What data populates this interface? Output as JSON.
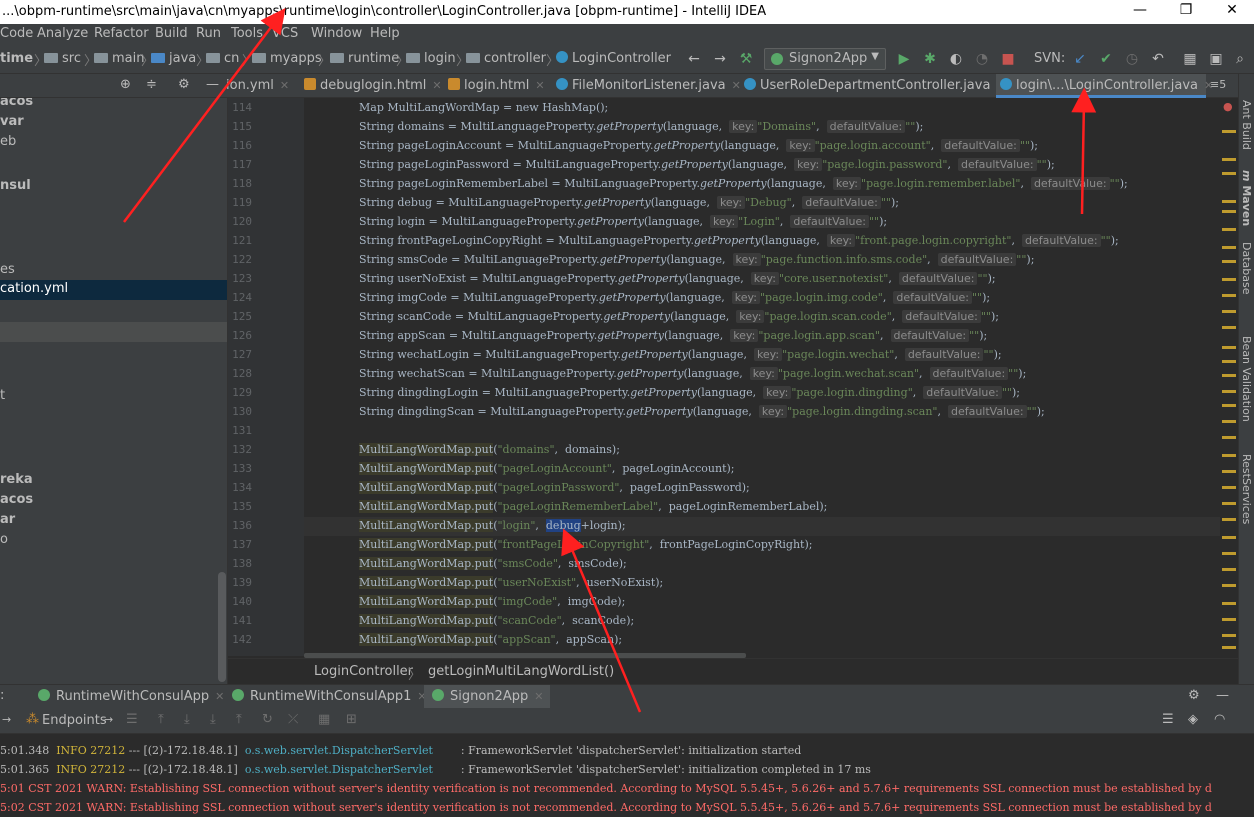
{
  "window": {
    "title": "...\\obpm-runtime\\src\\main\\java\\cn\\myapps\\runtime\\login\\controller\\LoginController.java [obpm-runtime] - IntelliJ IDEA",
    "minimize": "—",
    "maximize": "❐",
    "close": "✕"
  },
  "menu": [
    "Code",
    "Analyze",
    "Refactor",
    "Build",
    "Run",
    "Tools",
    "VCS",
    "Window",
    "Help"
  ],
  "breadcrumb": [
    "time",
    "src",
    "main",
    "java",
    "cn",
    "myapps",
    "runtime",
    "login",
    "controller",
    "LoginController"
  ],
  "toolbar": {
    "run_config": "Signon2App",
    "svn_label": "SVN:"
  },
  "tabs": [
    {
      "label": "ion.yml",
      "active": false
    },
    {
      "label": "debuglogin.html",
      "active": false
    },
    {
      "label": "login.html",
      "active": false
    },
    {
      "label": "FileMonitorListener.java",
      "active": false
    },
    {
      "label": "UserRoleDepartmentController.java",
      "active": false
    },
    {
      "label": "login\\...\\LoginController.java",
      "active": true
    }
  ],
  "tabs_overflow": "≡5",
  "left_panel": [
    {
      "label": "acos",
      "bold": true
    },
    {
      "label": "var",
      "bold": true
    },
    {
      "label": "eb",
      "bold": false
    },
    {
      "label": "nsul",
      "bold": true
    },
    {
      "label": "es",
      "bold": false
    },
    {
      "label": "cation.yml",
      "bold": false
    },
    {
      "label": "t",
      "bold": false
    },
    {
      "label": "reka",
      "bold": true
    },
    {
      "label": "acos",
      "bold": true
    },
    {
      "label": "ar",
      "bold": true
    },
    {
      "label": "o",
      "bold": false
    }
  ],
  "code": {
    "line_numbers": [
      "114",
      "115",
      "116",
      "117",
      "118",
      "119",
      "120",
      "121",
      "122",
      "123",
      "124",
      "125",
      "126",
      "127",
      "128",
      "129",
      "130",
      "131",
      "132",
      "133",
      "134",
      "135",
      "136",
      "137",
      "138",
      "139",
      "140",
      "141",
      "142"
    ],
    "first_line": "Map MultiLangWordMap = new HashMap();",
    "decls": [
      {
        "ln": "115",
        "name": "domains",
        "key": "Domains"
      },
      {
        "ln": "116",
        "name": "pageLoginAccount",
        "key": "page.login.account"
      },
      {
        "ln": "117",
        "name": "pageLoginPassword",
        "key": "page.login.password"
      },
      {
        "ln": "118",
        "name": "pageLoginRememberLabel",
        "key": "page.login.remember.label"
      },
      {
        "ln": "119",
        "name": "debug",
        "key": "Debug"
      },
      {
        "ln": "120",
        "name": "login",
        "key": "Login"
      },
      {
        "ln": "121",
        "name": "frontPageLoginCopyRight",
        "key": "front.page.login.copyright"
      },
      {
        "ln": "122",
        "name": "smsCode",
        "key": "page.function.info.sms.code"
      },
      {
        "ln": "123",
        "name": "userNoExist",
        "key": "core.user.notexist"
      },
      {
        "ln": "124",
        "name": "imgCode",
        "key": "page.login.img.code"
      },
      {
        "ln": "125",
        "name": "scanCode",
        "key": "page.login.scan.code"
      },
      {
        "ln": "126",
        "name": "appScan",
        "key": "page.login.app.scan"
      },
      {
        "ln": "127",
        "name": "wechatLogin",
        "key": "page.login.wechat"
      },
      {
        "ln": "128",
        "name": "wechatScan",
        "key": "page.login.wechat.scan"
      },
      {
        "ln": "129",
        "name": "dingdingLogin",
        "key": "page.login.dingding"
      },
      {
        "ln": "130",
        "name": "dingdingScan",
        "key": "page.login.dingding.scan"
      }
    ],
    "puts": [
      {
        "key": "domains",
        "val": "domains"
      },
      {
        "key": "pageLoginAccount",
        "val": "pageLoginAccount"
      },
      {
        "key": "pageLoginPassword",
        "val": "pageLoginPassword"
      },
      {
        "key": "pageLoginRememberLabel",
        "val": "pageLoginRememberLabel"
      },
      {
        "key": "login",
        "val": "debug+login"
      },
      {
        "key": "frontPageLoginCopyright",
        "val": "frontPageLoginCopyRight"
      },
      {
        "key": "smsCode",
        "val": "smsCode"
      },
      {
        "key": "userNoExist",
        "val": "userNoExist"
      },
      {
        "key": "imgCode",
        "val": "imgCode"
      },
      {
        "key": "scanCode",
        "val": "scanCode"
      },
      {
        "key": "appScan",
        "val": "appScan"
      }
    ],
    "hint_key": "key:",
    "hint_default": "defaultValue:",
    "type_string": "String",
    "lang_class": "MultiLanguageProperty",
    "get_method": "getProperty",
    "lang_arg": "language",
    "map_var": "MultiLangWordMap",
    "put_method": "put"
  },
  "editor_crumbs": [
    "LoginController",
    "getLoginMultiLangWordList()"
  ],
  "right_tools": [
    "Ant Build",
    "Maven",
    "Database",
    "Bean Validation",
    "RestServices"
  ],
  "run_tabs": [
    {
      "label": "RuntimeWithConsulApp",
      "active": false
    },
    {
      "label": "RuntimeWithConsulApp1",
      "active": false
    },
    {
      "label": "Signon2App",
      "active": true
    }
  ],
  "run_toolbar": {
    "endpoints": "Endpoints"
  },
  "console": [
    {
      "time": "5:01.348",
      "level": "INFO",
      "pid": "27212",
      "rest": "--- [(2)-172.18.48.1]",
      "cls": "o.s.web.servlet.DispatcherServlet",
      "msg": ": FrameworkServlet 'dispatcherServlet': initialization started",
      "warn": false
    },
    {
      "time": "5:01.365",
      "level": "INFO",
      "pid": "27212",
      "rest": "--- [(2)-172.18.48.1]",
      "cls": "o.s.web.servlet.DispatcherServlet",
      "msg": ": FrameworkServlet 'dispatcherServlet': initialization completed in 17 ms",
      "warn": false
    },
    {
      "text": "5:01 CST 2021 WARN: Establishing SSL connection without server's identity verification is not recommended. According to MySQL 5.5.45+, 5.6.26+ and 5.7.6+ requirements SSL connection must be established by d",
      "warn": true
    },
    {
      "text": "5:02 CST 2021 WARN: Establishing SSL connection without server's identity verification is not recommended. According to MySQL 5.5.45+, 5.6.26+ and 5.7.6+ requirements SSL connection must be established by d",
      "warn": true
    }
  ]
}
